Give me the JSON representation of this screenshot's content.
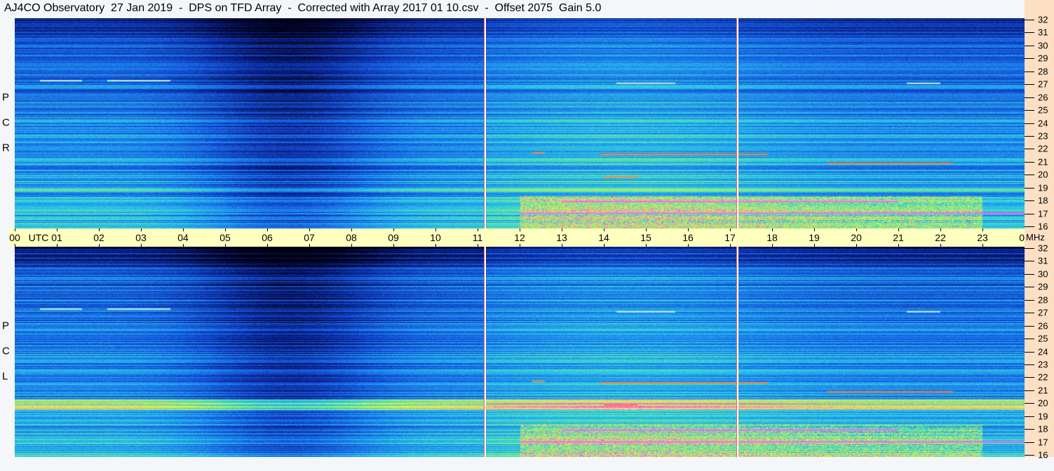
{
  "title": "AJ4CO Observatory  27 Jan 2019  -  DPS on TFD Array  -  Corrected with Array 2017 01 10.csv  -  Offset 2075  Gain 5.0",
  "chart_data": {
    "type": "heatmap",
    "title": "AJ4CO Observatory  27 Jan 2019  -  DPS on TFD Array  -  Corrected with Array 2017 01 10.csv  -  Offset 2075  Gain 5.0",
    "xlabel": "UTC",
    "ylabel": "MHz",
    "x_range_utc_hours": [
      0,
      24
    ],
    "y_range_mhz": [
      16,
      32
    ],
    "x_ticks": [
      "00",
      "01",
      "02",
      "03",
      "04",
      "05",
      "06",
      "07",
      "08",
      "09",
      "10",
      "11",
      "12",
      "13",
      "14",
      "15",
      "16",
      "17",
      "18",
      "19",
      "20",
      "21",
      "22",
      "23",
      "00"
    ],
    "y_ticks": [
      "16",
      "17",
      "18",
      "19",
      "20",
      "21",
      "22",
      "23",
      "24",
      "25",
      "26",
      "27",
      "28",
      "29",
      "30",
      "31",
      "32"
    ],
    "panels": [
      {
        "name": "RCP",
        "letters": [
          "R",
          "C",
          "P"
        ]
      },
      {
        "name": "LCP",
        "letters": [
          "L",
          "C",
          "P"
        ]
      }
    ],
    "markers_utc_hours": [
      11.17,
      17.17
    ],
    "colormap": [
      "#000010",
      "#0a1f8a",
      "#1450d8",
      "#1e90f0",
      "#30d0e0",
      "#80f080",
      "#f0f040",
      "#ff40ff",
      "#ffffff"
    ]
  }
}
